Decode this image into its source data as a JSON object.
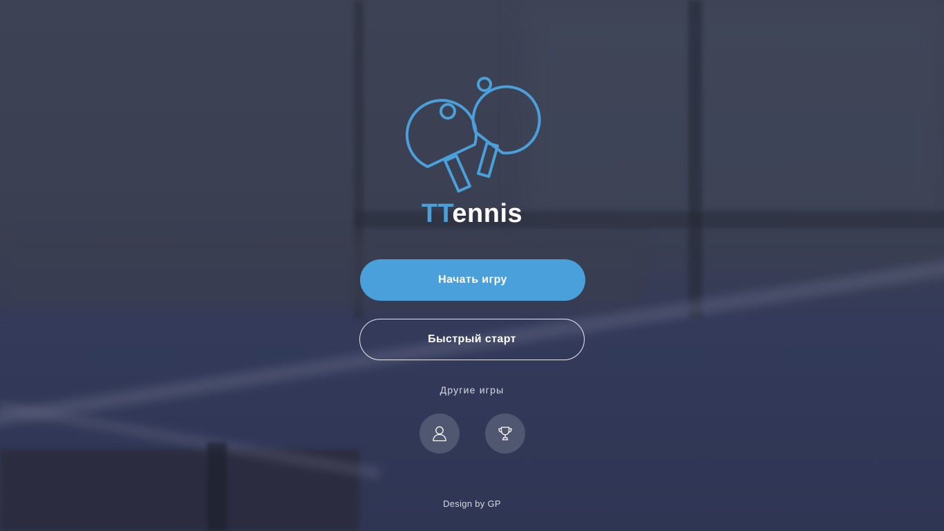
{
  "brand": {
    "accent": "TT",
    "rest": "ennis",
    "logo_icon": "ping-pong-paddles-icon"
  },
  "menu": {
    "start_game": "Начать игру",
    "quick_start": "Быстрый старт",
    "other_games": "Другие игры"
  },
  "other_games": {
    "items": [
      {
        "icon": "user-icon"
      },
      {
        "icon": "trophy-icon"
      }
    ]
  },
  "footer": {
    "credit": "Design by GP"
  },
  "colors": {
    "accent": "#4aa0da",
    "background": "#3a3f52",
    "text": "#ffffff"
  }
}
